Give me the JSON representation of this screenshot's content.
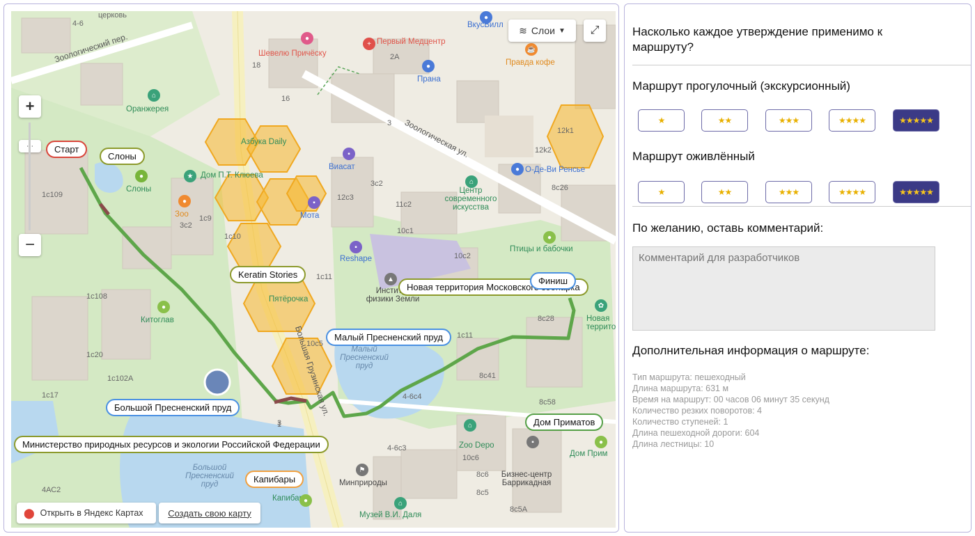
{
  "map": {
    "controls": {
      "layers_label": "Слои",
      "zoom_in": "+",
      "zoom_out": "−"
    },
    "footer": {
      "open_label": "Открыть в Яндекс Картах",
      "create_label": "Создать свою карту"
    },
    "callouts": {
      "start": "Старт",
      "elephants": "Слоны",
      "keratin": "Keratin Stories",
      "new_territory": "Новая территория Московского зоопарка",
      "finish": "Финиш",
      "small_pond": "Малый Пресненский пруд",
      "big_pond": "Большой Пресненский пруд",
      "ministry": "Министерство природных ресурсов и экологии Российской Федерации",
      "capybaras": "Капибары",
      "primates": "Дом Приматов"
    },
    "labels": {
      "zoo_lane": "Зоологический пер.",
      "zoo_street": "Зоологическая ул.",
      "big_gruz": "Большая Грузинская ул.",
      "orangery": "Оранжерея",
      "elephants_poi": "Слоны",
      "dom_klyuev": "Дом П.Т. Клюева",
      "azbuka": "Азбука Daily",
      "viasat": "Виасат",
      "mota": "Мота",
      "reshape": "Reshape",
      "zoo_poi": "Зоо",
      "pyaterochka": "Пятёрочка",
      "kitoglav": "Китоглав",
      "institute": "Институт физики Земли",
      "center_art": "Центр современного искусства",
      "birds": "Птицы и бабочки",
      "new_terr_poi": "Новая территория",
      "shevelyu": "Шевелю Причёску",
      "pervy_medcenter": "Первый Медцентр",
      "vkusvill": "ВкусВилл",
      "prana": "Прана",
      "pravda": "Правда кофе",
      "odevi": "О-Де-Ви Ренсье",
      "cerkov": "церковь",
      "zoo_depo": "Zoo Depo",
      "minprirody": "Минприроды",
      "capybaras_poi": "Капибары",
      "dahl": "Музей В.И. Даля",
      "biz_center": "Бизнес-центр Баррикадная",
      "dom_prim_poi": "Дом Прим",
      "small_pond_water": "Малый Пресненский пруд",
      "big_pond_water": "Большой Пресненский пруд"
    },
    "numbers": [
      "4-6",
      "18",
      "16",
      "2А",
      "3",
      "1с109",
      "1с9",
      "3с2",
      "1с10",
      "12с3",
      "3с2",
      "11с2",
      "10с1",
      "10с2",
      "1с108",
      "1с11",
      "10с5",
      "8с28",
      "1с20",
      "1с102А",
      "1с17",
      "8с41",
      "4-6с4",
      "8с58",
      "8с7",
      "4-6с3",
      "10с6",
      "3",
      "4АС2",
      "8с6",
      "8с5",
      "8с5А",
      "12k1",
      "12k2",
      "8с26",
      "1",
      "1с11"
    ]
  },
  "form": {
    "question": "Насколько каждое утверждение применимо к маршруту?",
    "statement1": "Маршрут прогулочный (экскурсионный)",
    "statement2": "Маршрут оживлённый",
    "ratings": [
      "★",
      "★★",
      "★★★",
      "★★★★",
      "★★★★★"
    ],
    "selected1": 5,
    "selected2": 5,
    "comment_prompt": "По желанию, оставь комментарий:",
    "comment_placeholder": "Комментарий для разработчиков",
    "info_title": "Дополнительная информация о маршруте:",
    "info_lines": [
      "Тип маршрута: пешеходный",
      "Длина маршрута: 631 м",
      "Время на маршрут: 00 часов 06 минут 35 секунд",
      "Количество резких поворотов: 4",
      "Количество ступеней: 1",
      "Длина пешеходной дороги: 604",
      "Длина лестницы: 10"
    ]
  },
  "colors": {
    "route": "#5ea64a",
    "hex": "#f7c63c",
    "water": "#b8d8ef",
    "park": "#cfe7bd",
    "accent": "#3b3a86"
  }
}
